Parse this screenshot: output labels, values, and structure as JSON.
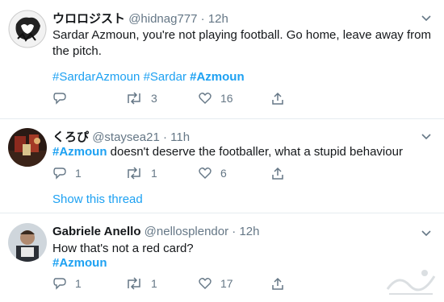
{
  "tweets": [
    {
      "name": "ウロロジスト",
      "handle": "@hidnag777",
      "dot": "·",
      "time": "12h",
      "text": "Sardar Azmoun, you're not playing football. Go home, leave away from the pitch.",
      "hashtags": [
        "#SardarAzmoun",
        "#Sardar",
        "#Azmoun"
      ],
      "replies": "",
      "retweets": "3",
      "likes": "16"
    },
    {
      "name": "くろぴ",
      "handle": "@staysea21",
      "dot": "·",
      "time": "11h",
      "hashtag": "#Azmoun",
      "text": " doesn't deserve the footballer, what a stupid behaviour",
      "replies": "1",
      "retweets": "1",
      "likes": "6",
      "show_thread": "Show this thread"
    },
    {
      "name": "Gabriele Anello",
      "handle": "@nellosplendor",
      "dot": "·",
      "time": "12h",
      "text": "How that's not a red card?",
      "hashtag": "#Azmoun",
      "replies": "1",
      "retweets": "1",
      "likes": "17"
    }
  ],
  "icons": {
    "reply": "reply-icon",
    "retweet": "retweet-icon",
    "like": "heart-icon",
    "share": "share-icon",
    "menu": "chevron-down-icon"
  },
  "colors": {
    "link": "#1da1f2",
    "muted": "#657786",
    "divider": "#e6ecf0"
  }
}
